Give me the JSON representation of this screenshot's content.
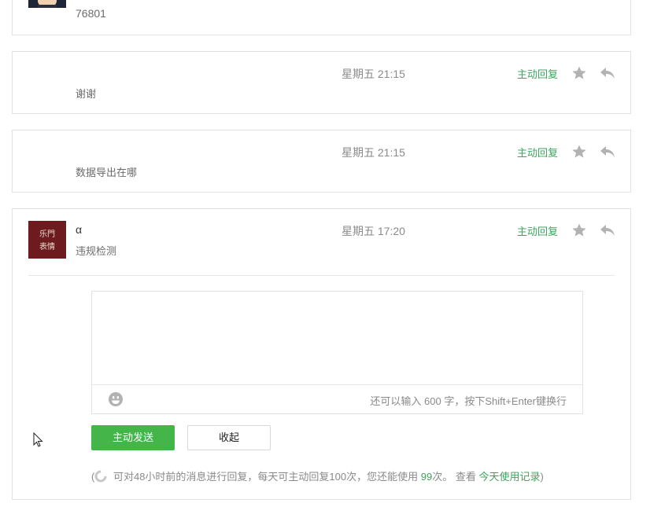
{
  "messages": [
    {
      "name": "",
      "content": "76801",
      "time": "",
      "reply_tag": ""
    },
    {
      "name": "",
      "content": "谢谢",
      "time": "星期五 21:15",
      "reply_tag": "主动回复"
    },
    {
      "name": "",
      "content": "数据导出在哪",
      "time": "星期五 21:15",
      "reply_tag": "主动回复"
    },
    {
      "name": "α",
      "content": "违规检测",
      "time": "星期五 17:20",
      "reply_tag": "主动回复"
    }
  ],
  "avatar_4": {
    "text_line1": "乐門",
    "text_line2": "表情"
  },
  "editor": {
    "value": "",
    "counter_text": "还可以输入 600 字，按下Shift+Enter键换行"
  },
  "buttons": {
    "send_label": "主动发送",
    "fold_label": "收起"
  },
  "tip": {
    "open_paren": "(",
    "text_main": "可对48小时前的消息进行回复，每天可主动回复100次，您还能使用",
    "remaining": "99",
    "text_unit": "次。 查看",
    "link_label": "今天使用记录",
    "close_paren": ")"
  },
  "colors": {
    "accent_green": "#44b549",
    "link_green": "#3ca45c",
    "border": "#e2e2e2",
    "avatar_bg": "#6e1b1f"
  },
  "icons": [
    "star-icon",
    "reply-arrow-icon",
    "emoji-icon",
    "loading-icon",
    "mouse-cursor-icon"
  ]
}
